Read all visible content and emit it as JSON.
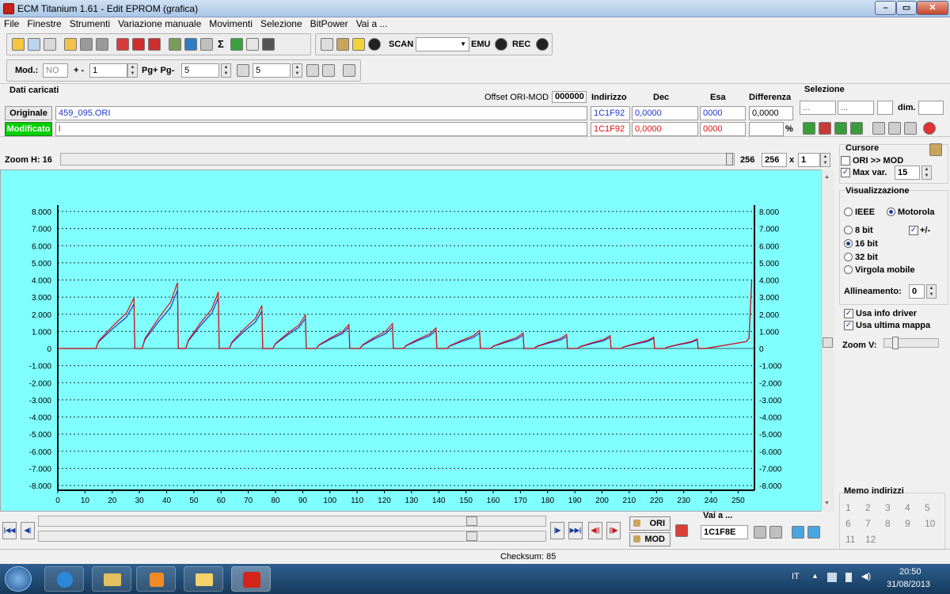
{
  "window": {
    "title": "ECM Titanium 1.61 - Edit EPROM (grafica)"
  },
  "menu": [
    "File",
    "Finestre",
    "Strumenti",
    "Variazione manuale",
    "Movimenti",
    "Selezione",
    "BitPower",
    "Vai a ..."
  ],
  "toolbar": {
    "scan_label": "SCAN",
    "emu_label": "EMU",
    "rec_label": "REC",
    "sigma": "Σ"
  },
  "toolbar2": {
    "mod_label": "Mod.:",
    "mod_value": "NO",
    "plusminus_label": "+ -",
    "plusminus_value": "1",
    "pg_label": "Pg+ Pg-",
    "pg_value": "5",
    "p_value": "5"
  },
  "dati": {
    "title": "Dati caricati",
    "offset_label": "Offset ORI-MOD",
    "offset_value": "000000",
    "headers": {
      "indirizzo": "Indirizzo",
      "dec": "Dec",
      "esa": "Esa",
      "differenza": "Differenza"
    },
    "originale": {
      "label": "Originale",
      "file": "459_095.ORI",
      "indirizzo": "1C1F92",
      "dec": "0,0000",
      "esa": "0000",
      "differenza": "0,0000"
    },
    "modificato": {
      "label": "Modificato",
      "file": "l",
      "indirizzo": "1C1F92",
      "dec": "0,0000",
      "esa": "0000",
      "percent": "%"
    }
  },
  "selezione": {
    "title": "Selezione",
    "field1": "...",
    "field2": "...",
    "dim_label": "dim."
  },
  "zoom": {
    "label": "Zoom H: 16",
    "value_text": "256",
    "value_field": "256",
    "x_label": "x",
    "multiplier": "1"
  },
  "cursore": {
    "title": "Cursore",
    "ori_mod_label": "ORI >> MOD",
    "ori_mod_checked": false,
    "maxvar_label": "Max var.",
    "maxvar_checked": true,
    "maxvar_value": "15"
  },
  "visualizzazione": {
    "title": "Visualizzazione",
    "ieee": "IEEE",
    "motorola": "Motorola",
    "motorola_selected": true,
    "bit8": "8 bit",
    "bit16": "16 bit",
    "bit32": "32 bit",
    "virgola": "Virgola mobile",
    "selected_bits": "16 bit",
    "plusminus": "+/-",
    "plusminus_checked": true,
    "allineamento_label": "Allineamento:",
    "allineamento_value": "0",
    "usa_info_driver": "Usa info driver",
    "usa_ultima_mappa": "Usa ultima mappa",
    "zoomv_label": "Zoom V:"
  },
  "memo": {
    "title": "Memo indirizzi",
    "numbers": [
      "1",
      "2",
      "3",
      "4",
      "5",
      "6",
      "7",
      "8",
      "9",
      "10",
      "11",
      "12"
    ]
  },
  "vaia": {
    "label": "Vai a ...",
    "value": "1C1F8E"
  },
  "ori_button": "ORI",
  "mod_button": "MOD",
  "status": {
    "checksum": "Checksum: 85"
  },
  "taskbar": {
    "lang": "IT",
    "time": "20:50",
    "date": "31/08/2013"
  },
  "colors": {
    "plot_bg": "#80ffff",
    "ori_line": "#1f35c8",
    "mod_line": "#e01010",
    "modificato_bg": "#00d000"
  },
  "chart_data": {
    "type": "line",
    "ylim": [
      -8000,
      8000
    ],
    "xlim": [
      0,
      256
    ],
    "y_ticks": [
      "8.000",
      "7.000",
      "6.000",
      "5.000",
      "4.000",
      "3.000",
      "2.000",
      "1.000",
      "0",
      "-1.000",
      "-2.000",
      "-3.000",
      "-4.000",
      "-5.000",
      "-6.000",
      "-7.000",
      "-8.000"
    ],
    "x_ticks": [
      "0",
      "10",
      "20",
      "30",
      "40",
      "50",
      "60",
      "70",
      "80",
      "90",
      "100",
      "110",
      "120",
      "130",
      "140",
      "150",
      "160",
      "170",
      "180",
      "190",
      "200",
      "210",
      "220",
      "230",
      "240",
      "250"
    ],
    "ori_peaks": [
      [
        28,
        2600
      ],
      [
        44,
        3400
      ],
      [
        59,
        2950
      ],
      [
        75,
        2200
      ],
      [
        91,
        1750
      ],
      [
        107,
        1250
      ],
      [
        123,
        1250
      ],
      [
        139,
        1050
      ],
      [
        155,
        900
      ],
      [
        171,
        780
      ],
      [
        187,
        700
      ],
      [
        203,
        650
      ],
      [
        219,
        580
      ],
      [
        235,
        500
      ]
    ],
    "mod_peaks": [
      [
        28,
        2950
      ],
      [
        44,
        3850
      ],
      [
        59,
        3300
      ],
      [
        75,
        2500
      ],
      [
        91,
        1950
      ],
      [
        107,
        1400
      ],
      [
        123,
        1450
      ],
      [
        139,
        1200
      ],
      [
        155,
        1050
      ],
      [
        171,
        900
      ],
      [
        187,
        820
      ],
      [
        203,
        750
      ],
      [
        219,
        660
      ],
      [
        235,
        560
      ]
    ],
    "ramp_starts": [
      14,
      31,
      47,
      63,
      79,
      95,
      111,
      127,
      143,
      159,
      175,
      191,
      207,
      223
    ],
    "tail": {
      "x_start": 238,
      "x_end": 255,
      "y_end": 4000
    }
  }
}
